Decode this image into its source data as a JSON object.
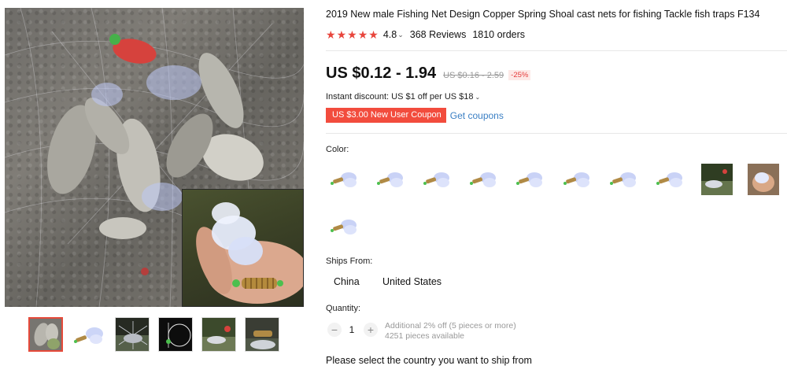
{
  "product": {
    "title": "2019 New male Fishing Net Design Copper Spring Shoal cast nets for fishing Tackle fish traps F134",
    "rating": "4.8",
    "reviews": "368 Reviews",
    "orders": "1810 orders",
    "price": "US $0.12 - 1.94",
    "original_price": "US $0.16 - 2.59",
    "discount": "-25%",
    "instant_discount": "Instant discount: US $1 off per US $18",
    "coupon_label": "US $3.00 New User Coupon",
    "get_coupons": "Get coupons"
  },
  "color": {
    "label": "Color:",
    "swatch_count": 11
  },
  "shipping": {
    "label": "Ships From:",
    "options": [
      "China",
      "United States"
    ]
  },
  "quantity": {
    "label": "Quantity:",
    "value": "1",
    "minus": "−",
    "plus": "+",
    "note_discount": "Additional 2% off (5 pieces or more)",
    "note_available": "4251 pieces available"
  },
  "ship_prompt": "Please select the country you want to ship from",
  "colors": {
    "accent_red": "#e8453c",
    "coupon_bg": "#f24c3d",
    "link_blue": "#3a7fc4",
    "muted": "#999999"
  }
}
